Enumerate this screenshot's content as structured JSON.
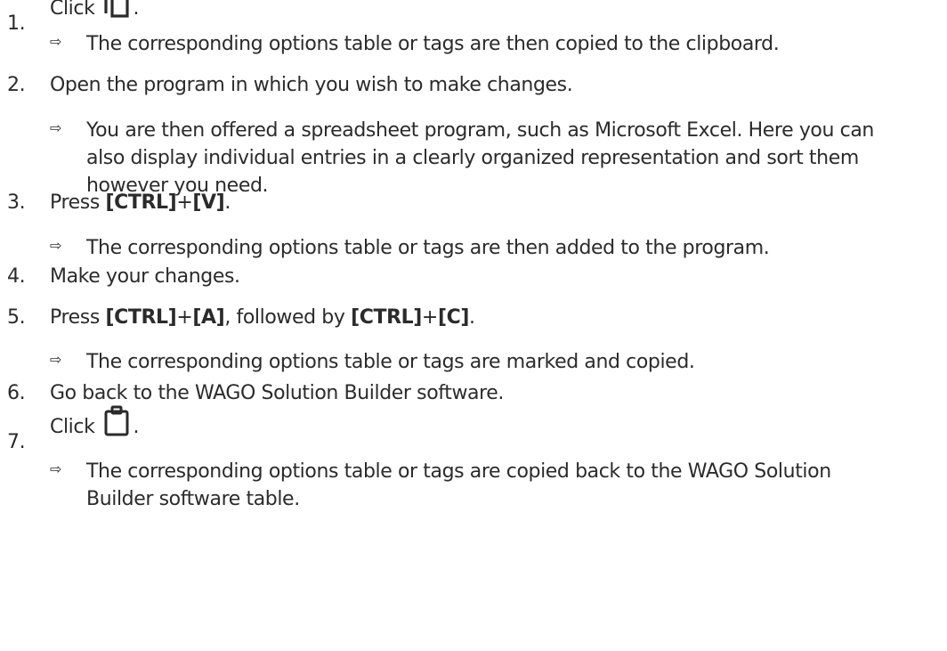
{
  "steps": [
    {
      "number": "1.",
      "before": "Click",
      "icon": "copy-icon",
      "after": ".",
      "result": "The corresponding options table or tags are then copied to the clipboard."
    },
    {
      "number": "2.",
      "text": "Open the program in which you wish to make changes.",
      "result_lines": [
        "You are then offered a spreadsheet program, such as Microsoft Excel. Here you can",
        "also display individual entries in a clearly organized representation and sort them",
        "however you need."
      ]
    },
    {
      "number": "3.",
      "prefix": "Press",
      "key1": "[CTRL]",
      "plus": "+",
      "key2": "[V]",
      "suffix": ".",
      "result": "The corresponding options table or tags are then added to the program."
    },
    {
      "number": "4.",
      "text": "Make your changes."
    },
    {
      "number": "5.",
      "prefix": "Press",
      "key1": "[CTRL]",
      "plus": "+",
      "key2": "[A]",
      "mid": ", followed by",
      "key3": "[CTRL]",
      "plus2": "+",
      "key4": "[C]",
      "suffix": ".",
      "result": "The corresponding options table or tags are marked and copied."
    },
    {
      "number": "6.",
      "text": "Go back to the WAGO Solution Builder software."
    },
    {
      "number": "7.",
      "before": "Click",
      "icon": "paste-icon",
      "after": ".",
      "result_lines": [
        "The corresponding options table or tags are copied back to the WAGO Solution",
        "Builder software table."
      ]
    }
  ],
  "result_arrow": "⇨"
}
